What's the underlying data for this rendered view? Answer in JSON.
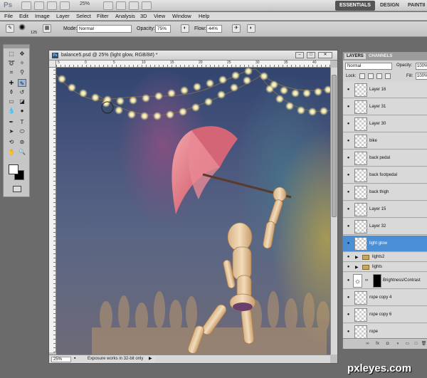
{
  "titlebar": {
    "app_logo": "Ps",
    "zoom": "25%",
    "workspaces": [
      "ESSENTIALS",
      "DESIGN",
      "PAINTII"
    ]
  },
  "menu": [
    "File",
    "Edit",
    "Image",
    "Layer",
    "Select",
    "Filter",
    "Analysis",
    "3D",
    "View",
    "Window",
    "Help"
  ],
  "options": {
    "brush_size": "125",
    "mode_label": "Mode:",
    "mode_value": "Normal",
    "opacity_label": "Opacity:",
    "opacity_value": "75%",
    "flow_label": "Flow:",
    "flow_value": "44%"
  },
  "document": {
    "title": "balance5.psd @ 25% (light glow, RGB/8#) *",
    "ruler_top": [
      "5",
      "0",
      "5",
      "10",
      "15",
      "20",
      "25",
      "30",
      "35",
      "40"
    ],
    "zoom": "25%",
    "status": "Exposure works in 32-bit only"
  },
  "layers_panel": {
    "tabs": [
      "LAYERS",
      "CHANNELS"
    ],
    "blend_mode": "Normal",
    "opacity_label": "Opacity:",
    "opacity_value": "100%",
    "lock_label": "Lock:",
    "fill_label": "Fill:",
    "fill_value": "100%",
    "layers": [
      {
        "name": "Layer 16",
        "type": "layer"
      },
      {
        "name": "Layer 31",
        "type": "layer"
      },
      {
        "name": "Layer 30",
        "type": "layer"
      },
      {
        "name": "bike",
        "type": "layer"
      },
      {
        "name": "back pedal",
        "type": "layer"
      },
      {
        "name": "back footpedal",
        "type": "layer"
      },
      {
        "name": "back thigh",
        "type": "layer"
      },
      {
        "name": "Layer 15",
        "type": "layer"
      },
      {
        "name": "Layer 32",
        "type": "layer"
      },
      {
        "name": "light glow",
        "type": "layer",
        "selected": true
      },
      {
        "name": "lights2",
        "type": "group"
      },
      {
        "name": "lights",
        "type": "group"
      },
      {
        "name": "Brightness/Contrast",
        "type": "adjustment"
      },
      {
        "name": "rope copy 4",
        "type": "layer"
      },
      {
        "name": "rope copy 6",
        "type": "layer"
      },
      {
        "name": "rope",
        "type": "layer"
      }
    ]
  },
  "watermark": "pxleyes.com",
  "colors": {
    "selected_layer": "#4a8fd6",
    "umbrella": "#e07a86",
    "mannequin": "#e8c9a0"
  }
}
